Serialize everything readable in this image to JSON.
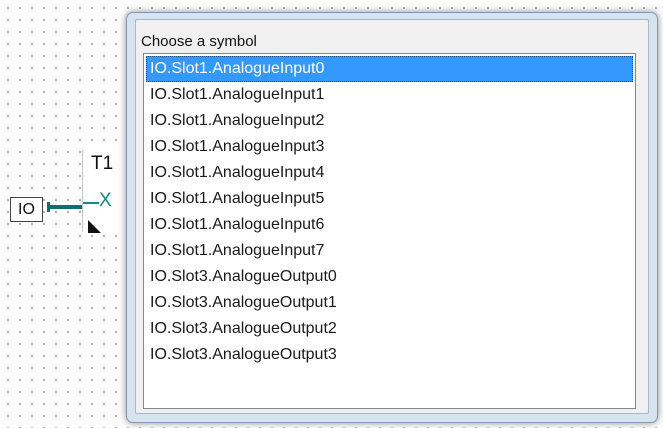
{
  "diagram": {
    "block_title": "T1",
    "block_pin": "X",
    "io_label": "IO"
  },
  "dialog": {
    "title": "Choose a symbol",
    "selected_index": 0,
    "items": [
      "IO.Slot1.AnalogueInput0",
      "IO.Slot1.AnalogueInput1",
      "IO.Slot1.AnalogueInput2",
      "IO.Slot1.AnalogueInput3",
      "IO.Slot1.AnalogueInput4",
      "IO.Slot1.AnalogueInput5",
      "IO.Slot1.AnalogueInput6",
      "IO.Slot1.AnalogueInput7",
      "IO.Slot3.AnalogueOutput0",
      "IO.Slot3.AnalogueOutput1",
      "IO.Slot3.AnalogueOutput2",
      "IO.Slot3.AnalogueOutput3"
    ]
  },
  "colors": {
    "selection": "#3399ff",
    "wire": "#0d6f6e",
    "pin": "#138a86"
  }
}
